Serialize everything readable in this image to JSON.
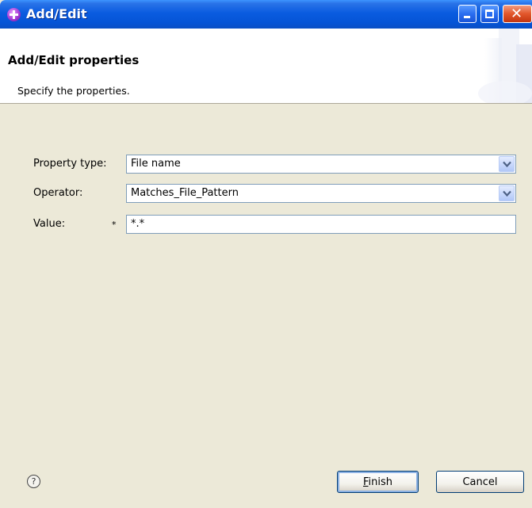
{
  "window": {
    "title": "Add/Edit"
  },
  "header": {
    "title": "Add/Edit properties",
    "description": "Specify the properties."
  },
  "form": {
    "property_type": {
      "label": "Property type:",
      "value": "File name"
    },
    "operator": {
      "label": "Operator:",
      "value": "Matches_File_Pattern"
    },
    "value": {
      "label": "Value:",
      "required_marker": "*",
      "value": "*.*"
    }
  },
  "footer": {
    "help_glyph": "?",
    "finish_mnemonic": "F",
    "finish_rest": "inish",
    "cancel_label": "Cancel"
  },
  "colors": {
    "title_bar": "#0554d6",
    "dialog_background": "#ece9d8",
    "field_border": "#7f9db9"
  },
  "icons": [
    "app-icon",
    "minimize-icon",
    "maximize-icon",
    "close-icon",
    "chevron-down-icon",
    "help-icon"
  ]
}
